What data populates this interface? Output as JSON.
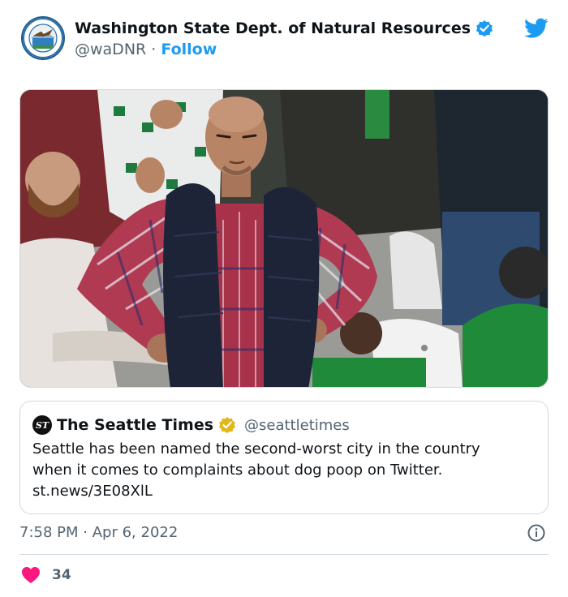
{
  "author": {
    "name": "Washington State Dept. of Natural Resources",
    "handle": "@waDNR",
    "separator": "·",
    "follow_label": "Follow",
    "avatar_icon": "wa-dnr-seal-icon",
    "verified_icon": "verified-badge-icon",
    "brand_icon": "twitter-bird-icon"
  },
  "media": {
    "photo_icon": "photo-man-hands-on-hips"
  },
  "quoted_tweet": {
    "name": "The Seattle Times",
    "handle": "@seattletimes",
    "logo_text": "ST",
    "verified_icon": "gold-verified-badge-icon",
    "text_lines": [
      "Seattle has been named the second-worst city in the country",
      "when it comes to complaints about dog poop on Twitter.",
      "st.news/3E08XlL"
    ]
  },
  "meta": {
    "time": "7:58 PM",
    "separator": "·",
    "date": "Apr 6, 2022",
    "info_icon": "info-icon"
  },
  "engagement": {
    "likes": "34",
    "like_icon": "heart-icon"
  },
  "colors": {
    "accent": "#1d9bf0",
    "heart": "#f91880",
    "gold_badge": "#e2b719",
    "secondary_text": "#536471",
    "border": "#cfd9de"
  }
}
